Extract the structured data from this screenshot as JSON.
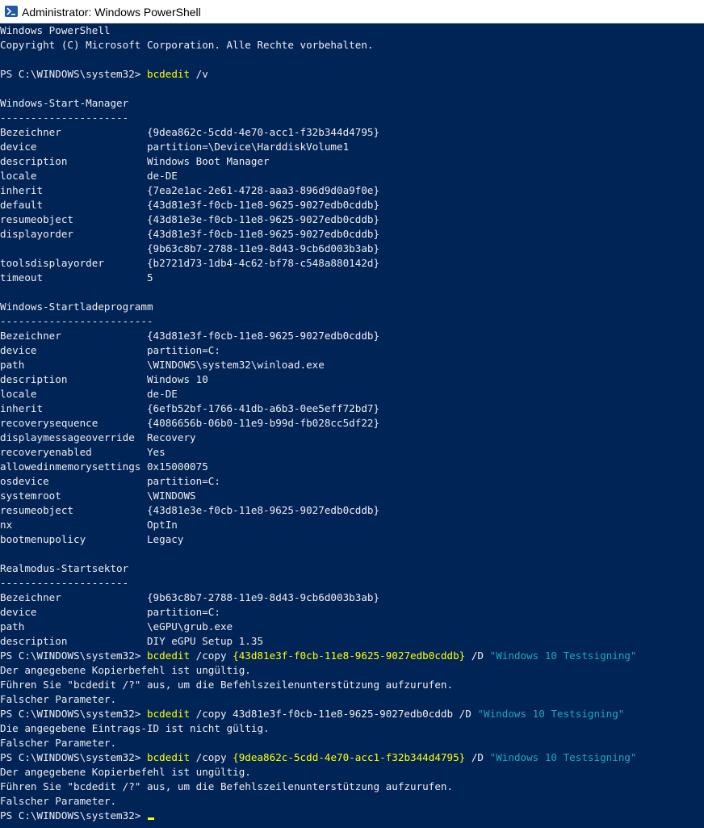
{
  "window": {
    "title": "Administrator: Windows PowerShell",
    "icon": "powershell-icon"
  },
  "colors": {
    "background": "#012456",
    "text": "#eeedf0",
    "command": "#ffff00",
    "string": "#20a8b5"
  },
  "console": {
    "lines": [
      [
        {
          "t": "Windows PowerShell",
          "c": "txt"
        }
      ],
      [
        {
          "t": "Copyright (C) Microsoft Corporation. Alle Rechte vorbehalten.",
          "c": "txt"
        }
      ],
      [],
      [
        {
          "t": "PS C:\\WINDOWS\\system32> ",
          "c": "txt"
        },
        {
          "t": "bcdedit",
          "c": "cmd"
        },
        {
          "t": " /v",
          "c": "txt"
        }
      ],
      [],
      [
        {
          "t": "Windows-Start-Manager",
          "c": "txt"
        }
      ],
      [
        {
          "t": "---------------------",
          "c": "txt"
        }
      ],
      [
        {
          "t": "Bezeichner              {9dea862c-5cdd-4e70-acc1-f32b344d4795}",
          "c": "txt"
        }
      ],
      [
        {
          "t": "device                  partition=\\Device\\HarddiskVolume1",
          "c": "txt"
        }
      ],
      [
        {
          "t": "description             Windows Boot Manager",
          "c": "txt"
        }
      ],
      [
        {
          "t": "locale                  de-DE",
          "c": "txt"
        }
      ],
      [
        {
          "t": "inherit                 {7ea2e1ac-2e61-4728-aaa3-896d9d0a9f0e}",
          "c": "txt"
        }
      ],
      [
        {
          "t": "default                 {43d81e3f-f0cb-11e8-9625-9027edb0cddb}",
          "c": "txt"
        }
      ],
      [
        {
          "t": "resumeobject            {43d81e3e-f0cb-11e8-9625-9027edb0cddb}",
          "c": "txt"
        }
      ],
      [
        {
          "t": "displayorder            {43d81e3f-f0cb-11e8-9625-9027edb0cddb}",
          "c": "txt"
        }
      ],
      [
        {
          "t": "                        {9b63c8b7-2788-11e9-8d43-9cb6d003b3ab}",
          "c": "txt"
        }
      ],
      [
        {
          "t": "toolsdisplayorder       {b2721d73-1db4-4c62-bf78-c548a880142d}",
          "c": "txt"
        }
      ],
      [
        {
          "t": "timeout                 5",
          "c": "txt"
        }
      ],
      [],
      [
        {
          "t": "Windows-Startladeprogramm",
          "c": "txt"
        }
      ],
      [
        {
          "t": "-------------------------",
          "c": "txt"
        }
      ],
      [
        {
          "t": "Bezeichner              {43d81e3f-f0cb-11e8-9625-9027edb0cddb}",
          "c": "txt"
        }
      ],
      [
        {
          "t": "device                  partition=C:",
          "c": "txt"
        }
      ],
      [
        {
          "t": "path                    \\WINDOWS\\system32\\winload.exe",
          "c": "txt"
        }
      ],
      [
        {
          "t": "description             Windows 10",
          "c": "txt"
        }
      ],
      [
        {
          "t": "locale                  de-DE",
          "c": "txt"
        }
      ],
      [
        {
          "t": "inherit                 {6efb52bf-1766-41db-a6b3-0ee5eff72bd7}",
          "c": "txt"
        }
      ],
      [
        {
          "t": "recoverysequence        {4086656b-06b0-11e9-b99d-fb028cc5df22}",
          "c": "txt"
        }
      ],
      [
        {
          "t": "displaymessageoverride  Recovery",
          "c": "txt"
        }
      ],
      [
        {
          "t": "recoveryenabled         Yes",
          "c": "txt"
        }
      ],
      [
        {
          "t": "allowedinmemorysettings 0x15000075",
          "c": "txt"
        }
      ],
      [
        {
          "t": "osdevice                partition=C:",
          "c": "txt"
        }
      ],
      [
        {
          "t": "systemroot              \\WINDOWS",
          "c": "txt"
        }
      ],
      [
        {
          "t": "resumeobject            {43d81e3e-f0cb-11e8-9625-9027edb0cddb}",
          "c": "txt"
        }
      ],
      [
        {
          "t": "nx                      OptIn",
          "c": "txt"
        }
      ],
      [
        {
          "t": "bootmenupolicy          Legacy",
          "c": "txt"
        }
      ],
      [],
      [
        {
          "t": "Realmodus-Startsektor",
          "c": "txt"
        }
      ],
      [
        {
          "t": "---------------------",
          "c": "txt"
        }
      ],
      [
        {
          "t": "Bezeichner              {9b63c8b7-2788-11e9-8d43-9cb6d003b3ab}",
          "c": "txt"
        }
      ],
      [
        {
          "t": "device                  partition=C:",
          "c": "txt"
        }
      ],
      [
        {
          "t": "path                    \\eGPU\\grub.exe",
          "c": "txt"
        }
      ],
      [
        {
          "t": "description             DIY eGPU Setup 1.35",
          "c": "txt"
        }
      ],
      [
        {
          "t": "PS C:\\WINDOWS\\system32> ",
          "c": "txt"
        },
        {
          "t": "bcdedit",
          "c": "cmd"
        },
        {
          "t": " /copy ",
          "c": "txt"
        },
        {
          "t": "{43d81e3f-f0cb-11e8-9625-9027edb0cddb}",
          "c": "cmd"
        },
        {
          "t": " /D ",
          "c": "txt"
        },
        {
          "t": "\"Windows 10 Testsigning\"",
          "c": "str"
        }
      ],
      [
        {
          "t": "Der angegebene Kopierbefehl ist ungültig.",
          "c": "txt"
        }
      ],
      [
        {
          "t": "Führen Sie \"bcdedit /?\" aus, um die Befehlszeilenunterstützung aufzurufen.",
          "c": "txt"
        }
      ],
      [
        {
          "t": "Falscher Parameter.",
          "c": "txt"
        }
      ],
      [
        {
          "t": "PS C:\\WINDOWS\\system32> ",
          "c": "txt"
        },
        {
          "t": "bcdedit",
          "c": "cmd"
        },
        {
          "t": " /copy 43d81e3f-f0cb-11e8-9625-9027edb0cddb /D ",
          "c": "txt"
        },
        {
          "t": "\"Windows 10 Testsigning\"",
          "c": "str"
        }
      ],
      [
        {
          "t": "Die angegebene Eintrags-ID ist nicht gültig.",
          "c": "txt"
        }
      ],
      [
        {
          "t": "Falscher Parameter.",
          "c": "txt"
        }
      ],
      [
        {
          "t": "PS C:\\WINDOWS\\system32> ",
          "c": "txt"
        },
        {
          "t": "bcdedit",
          "c": "cmd"
        },
        {
          "t": " /copy ",
          "c": "txt"
        },
        {
          "t": "{9dea862c-5cdd-4e70-acc1-f32b344d4795}",
          "c": "cmd"
        },
        {
          "t": " /D ",
          "c": "txt"
        },
        {
          "t": "\"Windows 10 Testsigning\"",
          "c": "str"
        }
      ],
      [
        {
          "t": "Der angegebene Kopierbefehl ist ungültig.",
          "c": "txt"
        }
      ],
      [
        {
          "t": "Führen Sie \"bcdedit /?\" aus, um die Befehlszeilenunterstützung aufzurufen.",
          "c": "txt"
        }
      ],
      [
        {
          "t": "Falscher Parameter.",
          "c": "txt"
        }
      ],
      [
        {
          "t": "PS C:\\WINDOWS\\system32> ",
          "c": "txt"
        }
      ]
    ]
  }
}
